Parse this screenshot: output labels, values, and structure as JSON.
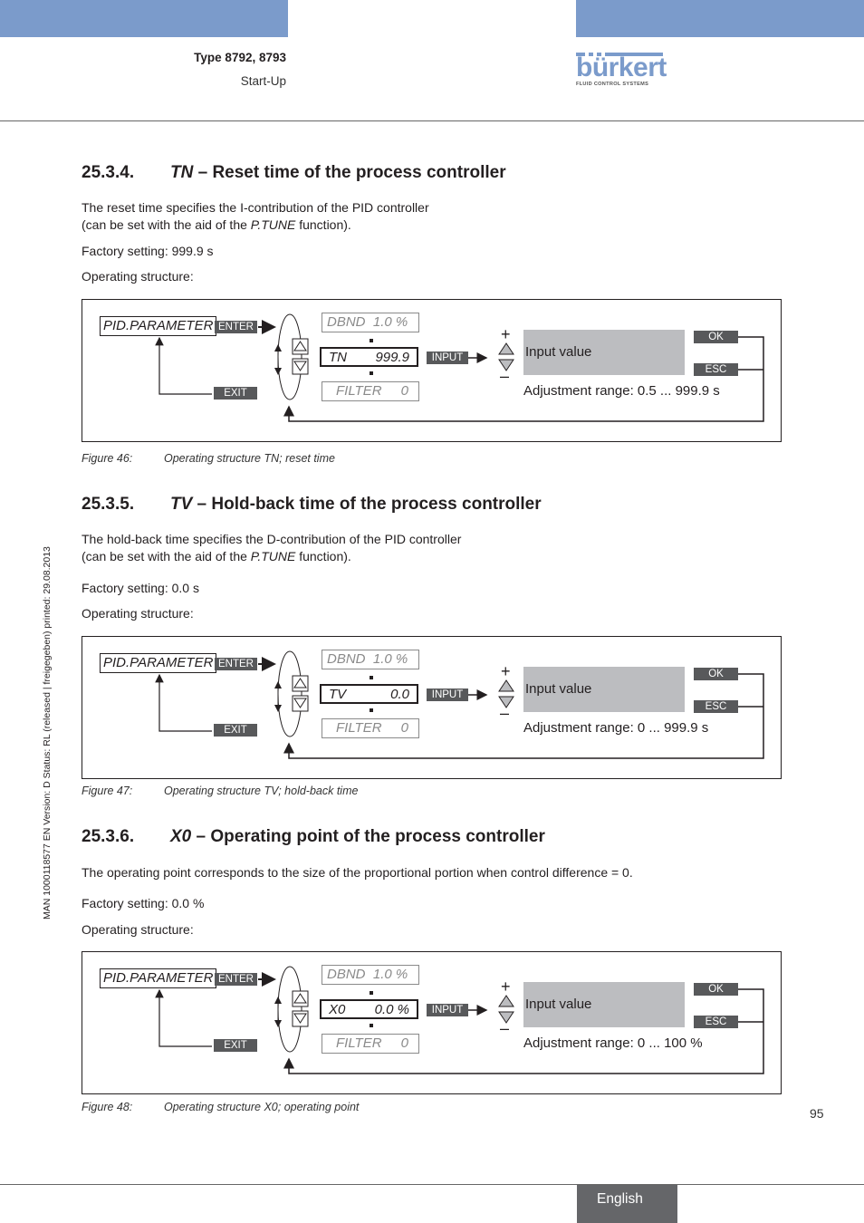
{
  "header": {
    "doc_type": "Type 8792, 8793",
    "chapter": "Start-Up",
    "logo_word": "bürkert",
    "logo_tagline": "FLUID CONTROL SYSTEMS",
    "brand_color": "#7b9bcb"
  },
  "side_note": "MAN  1000118577  EN  Version: D  Status: RL (released | freigegeben)  printed: 29.08.2013",
  "sections": [
    {
      "number": "25.3.4.",
      "symbol": "TN",
      "title": " – Reset time of the process controller",
      "desc_line1": "The reset time specifies the I-contribution of the PID controller",
      "desc_line2_pre": "(can be set with the aid of the ",
      "desc_line2_fn": "P.TUNE",
      "desc_line2_post": " function).",
      "factory": "Factory setting: 999.9 s",
      "operating": "Operating structure:",
      "diagram": {
        "menu": "PID.PARAMETER",
        "enter": "ENTER",
        "exit": "EXIT",
        "prev_key": "DBND",
        "prev_val": "1.0 %",
        "cur_key": "TN",
        "cur_val": "999.9",
        "next_key": "FILTER",
        "next_val": "0",
        "input": "INPUT",
        "input_label": "Input value",
        "ok": "OK",
        "esc": "ESC",
        "plus": "+",
        "minus": "–",
        "range": "Adjustment range: 0.5 ... 999.9 s"
      },
      "caption_num": "Figure 46:",
      "caption_text": "Operating structure TN; reset time"
    },
    {
      "number": "25.3.5.",
      "symbol": "TV",
      "title": " – Hold-back time of the process controller",
      "desc_line1": "The hold-back time specifies the D-contribution of the PID controller",
      "desc_line2_pre": "(can be set with the aid of the ",
      "desc_line2_fn": "P.TUNE",
      "desc_line2_post": " function).",
      "factory": "Factory setting: 0.0 s",
      "operating": "Operating structure:",
      "diagram": {
        "menu": "PID.PARAMETER",
        "enter": "ENTER",
        "exit": "EXIT",
        "prev_key": "DBND",
        "prev_val": "1.0 %",
        "cur_key": "TV",
        "cur_val": "0.0",
        "next_key": "FILTER",
        "next_val": "0",
        "input": "INPUT",
        "input_label": "Input value",
        "ok": "OK",
        "esc": "ESC",
        "plus": "+",
        "minus": "–",
        "range": "Adjustment range: 0 ... 999.9 s"
      },
      "caption_num": "Figure 47:",
      "caption_text": "Operating structure TV; hold-back time"
    },
    {
      "number": "25.3.6.",
      "symbol": "X0",
      "title": " – Operating point of the process controller",
      "desc_line1": "The operating point corresponds to the size of the proportional portion when control difference = 0.",
      "factory": "Factory setting: 0.0 %",
      "operating": "Operating structure:",
      "diagram": {
        "menu": "PID.PARAMETER",
        "enter": "ENTER",
        "exit": "EXIT",
        "prev_key": "DBND",
        "prev_val": "1.0 %",
        "cur_key": "X0",
        "cur_val": "0.0 %",
        "next_key": "FILTER",
        "next_val": "0",
        "input": "INPUT",
        "input_label": "Input value",
        "ok": "OK",
        "esc": "ESC",
        "plus": "+",
        "minus": "–",
        "range": "Adjustment range: 0 ... 100 %"
      },
      "caption_num": "Figure 48:",
      "caption_text": "Operating structure X0; operating point"
    }
  ],
  "footer": {
    "page_number": "95",
    "language": "English"
  }
}
